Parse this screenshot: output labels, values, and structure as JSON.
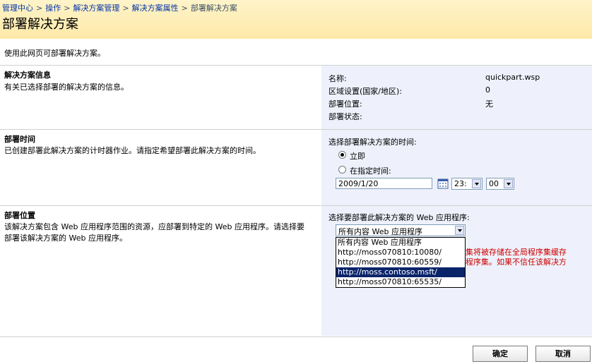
{
  "breadcrumb": {
    "items": [
      "管理中心",
      "操作",
      "解决方案管理",
      "解决方案属性"
    ],
    "current": "部署解决方案",
    "separator": ">"
  },
  "page_title": "部署解决方案",
  "page_description": "使用此网页可部署解决方案。",
  "solution_info": {
    "title": "解决方案信息",
    "description": "有关已选择部署的解决方案的信息。",
    "fields": [
      {
        "label": "名称:",
        "value": "quickpart.wsp"
      },
      {
        "label": "区域设置(国家/地区):",
        "value": "0"
      },
      {
        "label": "部署位置:",
        "value": "无"
      },
      {
        "label": "部署状态:",
        "value": ""
      }
    ]
  },
  "deploy_time": {
    "title": "部署时间",
    "description": "已创建部署此解决方案的计时器作业。请指定希望部署此解决方案的时间。",
    "prompt": "选择部署解决方案的时间:",
    "option_now": "立即",
    "option_specific": "在指定时间:",
    "date_value": "2009/1/20",
    "hour_value": "23:",
    "minute_value": "00"
  },
  "deploy_location": {
    "title": "部署位置",
    "description": "该解决方案包含 Web 应用程序范围的资源，应部署到特定的 Web 应用程序。请选择要部署该解决方案的 Web 应用程序。",
    "prompt": "选择要部署此解决方案的 Web 应用程序:",
    "selected": "所有内容 Web 应用程序",
    "options": [
      "所有内容 Web 应用程序",
      "http://moss070810:10080/",
      "http://moss070810:60559/",
      "http://moss.contoso.msft/",
      "http://moss070810:65535/"
    ],
    "highlighted_index": 3,
    "warning_line1": "集将被存储在全局程序集缓存",
    "warning_line2": "程序集。如果不信任该解决方"
  },
  "buttons": {
    "ok": "确定",
    "cancel": "取消"
  },
  "colors": {
    "header_bg": "#fde9a8",
    "right_pane_bg": "#eef1fb",
    "link": "#0033aa",
    "warning": "#cc0000",
    "highlight": "#0a246a"
  }
}
